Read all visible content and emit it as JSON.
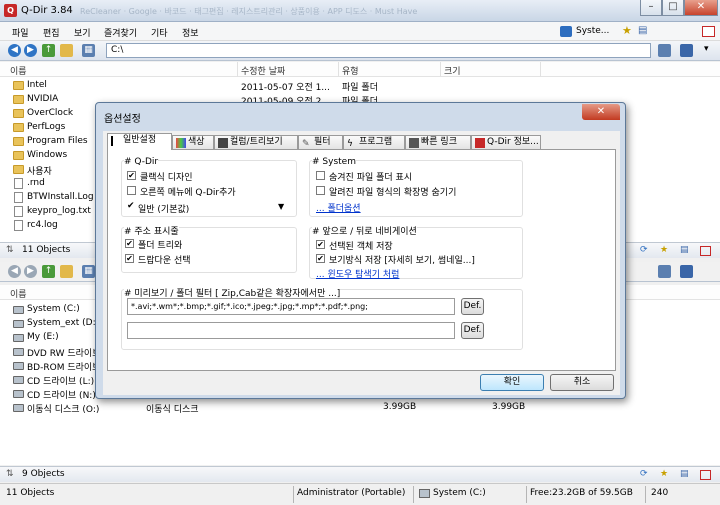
{
  "window": {
    "title": "Q-Dir 3.84",
    "ghost_tabs": "ReCleaner · Google · 바코드 · 태그편집 · 레지스트리관리 · 상품이용 · APP 디도스 · Must Have"
  },
  "menu": [
    "파일",
    "편집",
    "보기",
    "즐겨찾기",
    "기타",
    "정보"
  ],
  "top_toolbar": {
    "address": "C:\\",
    "system_label": "Syste..."
  },
  "top_pane": {
    "columns": [
      "이름",
      "수정한 날짜",
      "유형",
      "크기"
    ],
    "rows": [
      {
        "name": "Intel",
        "date": "2011-05-07 오전 1...",
        "type": "파일 폴더",
        "icon": "folder"
      },
      {
        "name": "NVIDIA",
        "date": "2011-05-09 오전 2...",
        "type": "파일 폴더",
        "icon": "folder"
      },
      {
        "name": "OverClock",
        "icon": "folder"
      },
      {
        "name": "PerfLogs",
        "icon": "folder"
      },
      {
        "name": "Program Files",
        "icon": "folder"
      },
      {
        "name": "Windows",
        "icon": "folder"
      },
      {
        "name": "사용자",
        "icon": "folder"
      },
      {
        "name": ".rnd",
        "icon": "file"
      },
      {
        "name": "BTWInstall.Log",
        "icon": "file"
      },
      {
        "name": "keypro_log.txt",
        "icon": "file"
      },
      {
        "name": "rc4.log",
        "icon": "file"
      }
    ],
    "status": "11 Objects"
  },
  "bottom_pane": {
    "columns": [
      "이름"
    ],
    "rows": [
      {
        "name": "System (C:)"
      },
      {
        "name": "System_ext (D:)"
      },
      {
        "name": "My (E:)"
      },
      {
        "name": "DVD RW 드라이브"
      },
      {
        "name": "BD-ROM 드라이브"
      },
      {
        "name": "CD 드라이브 (L:)"
      },
      {
        "name": "CD 드라이브 (N:)"
      },
      {
        "name": "이동식 디스크 (O:)",
        "type": "이동식 디스크",
        "total": "3.99GB",
        "free": "3.99GB"
      }
    ],
    "status": "9 Objects"
  },
  "status_bar": {
    "objects": "11 Objects",
    "user": "Administrator (Portable)",
    "drive": "System (C:)",
    "free": "Free:23.2GB of 59.5GB",
    "count": "240"
  },
  "dialog": {
    "title": "옵션설정",
    "tabs": [
      "일반설정",
      "색상",
      "컬럼/트리보기",
      "필터",
      "프로그램",
      "빠른 링크",
      "Q-Dir 정보..."
    ],
    "qdir_group": {
      "header": "# Q-Dir",
      "classic_design": "클랙식 디자인",
      "right_menu": "오른쪽 메뉴에 Q-Dir추가",
      "preset": "일반 (기본값)"
    },
    "system_group": {
      "header": "# System",
      "hidden_folders": "숨겨진 파일 폴더 표시",
      "hide_ext": "알려진 파일 형식의 확장명 숨기기",
      "folder_options": "... 폴더옵션"
    },
    "address_group": {
      "header": "# 주소 표시줄",
      "folder_tree": "폴더 트리와",
      "dropdown": "드랍다운 선택"
    },
    "nav_group": {
      "header": "# 앞으로 / 뒤로 네비게이션",
      "save_selection": "선택된 객체 저장",
      "save_view": "보기방식 저장 [자세히 보기, 썸네일...]",
      "explorer_like": "... 윈도우 탐색기 처럼"
    },
    "filter_group": {
      "header": "# 미리보기 / 폴더 필터 [ Zip,Cab같은 확장자에서만 ...]",
      "filter1": "*.avi;*.wm*;*.bmp;*.gif;*.ico;*.jpeg;*.jpg;*.mp*;*.pdf;*.png;",
      "filter2": "",
      "def_label": "Def."
    },
    "ok": "확인",
    "cancel": "취소"
  },
  "colors": {
    "titlebar": "#c9d6e6",
    "dialog_frame": "#cfdbea",
    "link": "#0033cc",
    "close_button": "#c23a21"
  }
}
